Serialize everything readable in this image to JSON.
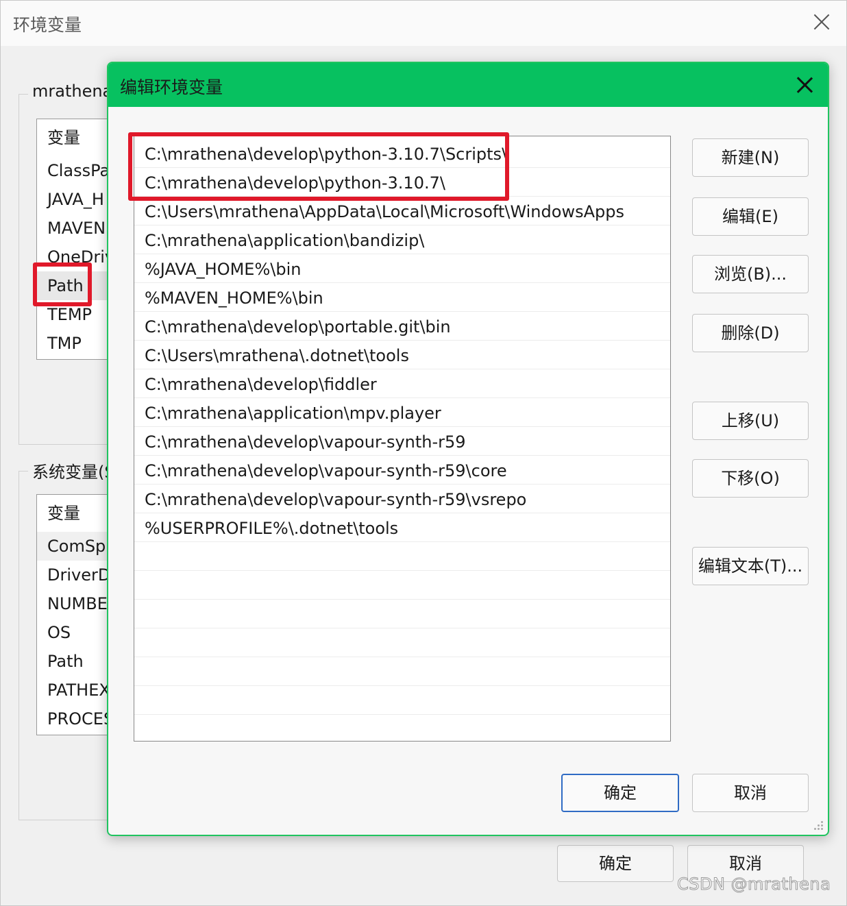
{
  "background_window": {
    "title": "环境变量",
    "user_vars_label": "mrathena",
    "user_vars_header": "变量",
    "user_vars": [
      "ClassPa",
      "JAVA_H",
      "MAVEN",
      "OneDriv",
      "Path",
      "TEMP",
      "TMP"
    ],
    "system_vars_label": "系统变量(S",
    "system_vars_header": "变量",
    "system_vars": [
      "ComSp",
      "DriverD",
      "NUMBE",
      "OS",
      "Path",
      "PATHEX",
      "PROCES"
    ],
    "ok_label": "确定",
    "cancel_label": "取消"
  },
  "dialog": {
    "title": "编辑环境变量",
    "paths": [
      "C:\\mrathena\\develop\\python-3.10.7\\Scripts\\",
      "C:\\mrathena\\develop\\python-3.10.7\\",
      "C:\\Users\\mrathena\\AppData\\Local\\Microsoft\\WindowsApps",
      "C:\\mrathena\\application\\bandizip\\",
      "%JAVA_HOME%\\bin",
      "%MAVEN_HOME%\\bin",
      "C:\\mrathena\\develop\\portable.git\\bin",
      "C:\\Users\\mrathena\\.dotnet\\tools",
      "C:\\mrathena\\develop\\fiddler",
      "C:\\mrathena\\application\\mpv.player",
      "C:\\mrathena\\develop\\vapour-synth-r59",
      "C:\\mrathena\\develop\\vapour-synth-r59\\core",
      "C:\\mrathena\\develop\\vapour-synth-r59\\vsrepo",
      "%USERPROFILE%\\.dotnet\\tools",
      "",
      "",
      "",
      "",
      "",
      "",
      ""
    ],
    "buttons": {
      "new": "新建(N)",
      "edit": "编辑(E)",
      "browse": "浏览(B)...",
      "delete": "删除(D)",
      "move_up": "上移(U)",
      "move_down": "下移(O)",
      "edit_text": "编辑文本(T)..."
    },
    "ok_label": "确定",
    "cancel_label": "取消"
  },
  "watermark": "CSDN @mrathena",
  "colors": {
    "dialog_titlebar": "#07c160",
    "highlight": "#e0192a",
    "default_button_border": "#2f6bc4"
  }
}
